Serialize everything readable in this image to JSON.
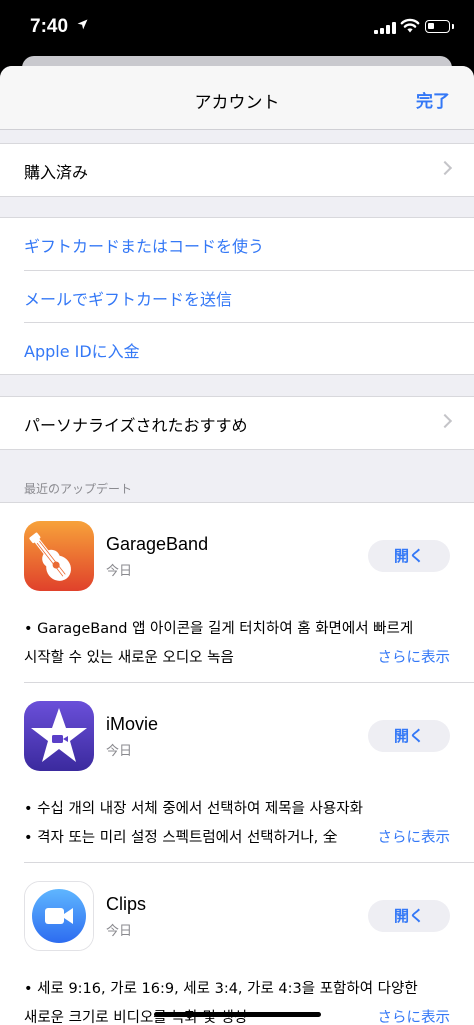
{
  "status_bar": {
    "time": "7:40",
    "location_icon": "location-arrow-icon",
    "signal_icon": "cellular-signal-icon",
    "wifi_icon": "wifi-icon",
    "battery_icon": "battery-icon"
  },
  "nav": {
    "title": "アカウント",
    "done_label": "完了"
  },
  "groups": {
    "purchased": {
      "label": "購入済み"
    },
    "gift": {
      "redeem": "ギフトカードまたはコードを使う",
      "send": "メールでギフトカードを送信",
      "add_funds": "Apple IDに入金"
    },
    "personalized": {
      "label": "パーソナライズされたおすすめ"
    }
  },
  "recent_updates": {
    "header": "最近のアップデート",
    "apps": [
      {
        "name": "GarageBand",
        "date": "今日",
        "button": "開く",
        "note_lines": [
          "• GarageBand 앱 아이콘을 길게 터치하여 홈 화면에서 빠르게",
          "시작할 수 있는 새로운 오디오 녹음"
        ],
        "more": "さらに表示",
        "icon": "garageband-icon"
      },
      {
        "name": "iMovie",
        "date": "今日",
        "button": "開く",
        "note_lines": [
          "• 수십 개의 내장 서체 중에서 선택하여 제목을 사용자화",
          "• 격자 또는 미리 설정 스펙트럼에서 선택하거나, 全"
        ],
        "more": "さらに表示",
        "icon": "imovie-icon"
      },
      {
        "name": "Clips",
        "date": "今日",
        "button": "開く",
        "note_lines": [
          "• 세로 9:16, 가로 16:9, 세로 3:4, 가로 4:3을 포함하여 다양한",
          "새로운 크기로 비디오를 녹화 및 생성"
        ],
        "more": "さらに表示",
        "icon": "clips-icon"
      }
    ]
  },
  "colors": {
    "accent": "#3478f6",
    "background": "#efeff4",
    "secondary_text": "#8a8a8f"
  }
}
